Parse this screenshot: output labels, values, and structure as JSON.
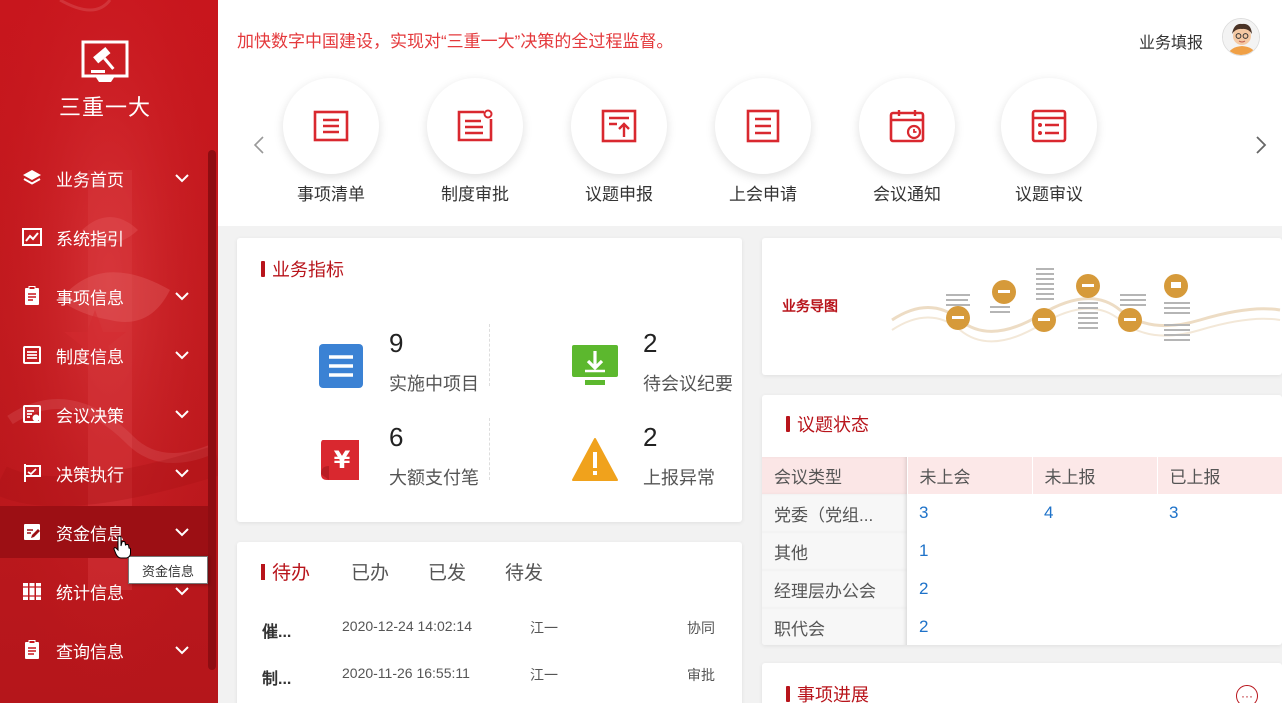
{
  "app": {
    "logo_text": "三重一大"
  },
  "sidebar": {
    "items": [
      {
        "label": "业务首页",
        "icon": "layers-icon",
        "expandable": true
      },
      {
        "label": "系统指引",
        "icon": "chart-icon",
        "expandable": false
      },
      {
        "label": "事项信息",
        "icon": "clipboard-icon",
        "expandable": true
      },
      {
        "label": "制度信息",
        "icon": "list-icon",
        "expandable": true
      },
      {
        "label": "会议决策",
        "icon": "meeting-icon",
        "expandable": true
      },
      {
        "label": "决策执行",
        "icon": "flag-icon",
        "expandable": true
      },
      {
        "label": "资金信息",
        "icon": "edit-icon",
        "expandable": true,
        "active": true
      },
      {
        "label": "统计信息",
        "icon": "books-icon",
        "expandable": true
      },
      {
        "label": "查询信息",
        "icon": "document-icon",
        "expandable": true
      }
    ],
    "tooltip": "资金信息"
  },
  "header": {
    "slogan": "加快数字中国建设，实现对“三重一大”决策的全过程监督。",
    "user_label": "业务填报"
  },
  "quick_menu": [
    {
      "label": "事项清单",
      "icon": "list-doc-icon"
    },
    {
      "label": "制度审批",
      "icon": "approve-doc-icon"
    },
    {
      "label": "议题申报",
      "icon": "upload-doc-icon"
    },
    {
      "label": "上会申请",
      "icon": "request-doc-icon"
    },
    {
      "label": "会议通知",
      "icon": "calendar-clock-icon"
    },
    {
      "label": "议题审议",
      "icon": "review-list-icon"
    }
  ],
  "metrics": {
    "title": "业务指标",
    "items": [
      {
        "value": "9",
        "label": "实施中项目",
        "icon": "list-box-icon",
        "color": "#3b82d4"
      },
      {
        "value": "2",
        "label": "待会议纪要",
        "icon": "monitor-download-icon",
        "color": "#5cb82e"
      },
      {
        "value": "6",
        "label": "大额支付笔",
        "icon": "yuan-scroll-icon",
        "color": "#d9282f"
      },
      {
        "value": "2",
        "label": "上报异常",
        "icon": "warning-icon",
        "color": "#f0a21c"
      }
    ]
  },
  "todo": {
    "tabs": [
      "待办",
      "已办",
      "已发",
      "待发"
    ],
    "rows": [
      {
        "title": "催...",
        "time": "2020-12-24 14:02:14",
        "user": "江一",
        "type": "协同"
      },
      {
        "title": "制...",
        "time": "2020-11-26 16:55:11",
        "user": "江一",
        "type": "审批"
      }
    ]
  },
  "guide": {
    "title": "业务导图"
  },
  "status": {
    "title": "议题状态",
    "columns": [
      "会议类型",
      "未上会",
      "未上报",
      "已上报"
    ],
    "rows": [
      {
        "type": "党委（党组...",
        "v1": "3",
        "v2": "4",
        "v3": "3"
      },
      {
        "type": "其他",
        "v1": "1",
        "v2": "",
        "v3": ""
      },
      {
        "type": "经理层办公会",
        "v1": "2",
        "v2": "",
        "v3": ""
      },
      {
        "type": "职代会",
        "v1": "2",
        "v2": "",
        "v3": ""
      }
    ]
  },
  "progress": {
    "title": "事项进展"
  },
  "colors": {
    "primary": "#b8141b",
    "sidebar": "#c8161d",
    "slogan": "#e4393c",
    "link": "#1e72c9"
  }
}
